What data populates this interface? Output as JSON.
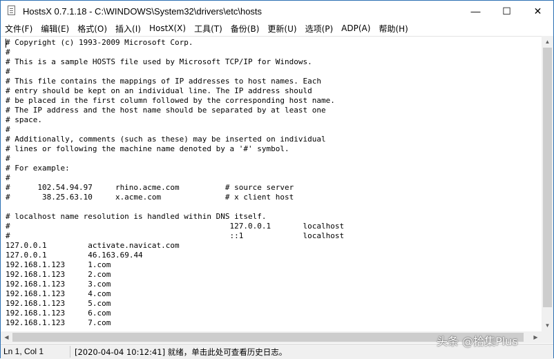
{
  "window": {
    "title": "HostsX 0.7.1.18 - C:\\WINDOWS\\System32\\drivers\\etc\\hosts",
    "minimize_glyph": "—",
    "maximize_glyph": "☐",
    "close_glyph": "✕"
  },
  "menu": [
    "文件(F)",
    "编辑(E)",
    "格式(O)",
    "插入(I)",
    "HostX(X)",
    "工具(T)",
    "备份(B)",
    "更新(U)",
    "选项(P)",
    "ADP(A)",
    "帮助(H)"
  ],
  "editor": {
    "text": "# Copyright (c) 1993-2009 Microsoft Corp.\n#\n# This is a sample HOSTS file used by Microsoft TCP/IP for Windows.\n#\n# This file contains the mappings of IP addresses to host names. Each\n# entry should be kept on an individual line. The IP address should\n# be placed in the first column followed by the corresponding host name.\n# The IP address and the host name should be separated by at least one\n# space.\n#\n# Additionally, comments (such as these) may be inserted on individual\n# lines or following the machine name denoted by a '#' symbol.\n#\n# For example:\n#\n#      102.54.94.97     rhino.acme.com          # source server\n#       38.25.63.10     x.acme.com              # x client host\n\n# localhost name resolution is handled within DNS itself.\n#\t\t\t\t\t\t 127.0.0.1       localhost\n#\t\t\t\t\t\t ::1             localhost\n127.0.0.1\t  activate.navicat.com\n127.0.0.1\t  46.163.69.44\n192.168.1.123\t  1.com\n192.168.1.123\t  2.com\n192.168.1.123\t  3.com\n192.168.1.123\t  4.com\n192.168.1.123\t  5.com\n192.168.1.123\t  6.com\n192.168.1.123\t  7.com"
  },
  "status": {
    "position": "Ln 1, Col 1",
    "message": "[2020-04-04 10:12:41] 就绪，单击此处可查看历史日志。"
  },
  "watermark": "头条 @拾集Plus",
  "icons": {
    "app": "notepad-page-icon",
    "scroll_up": "▲",
    "scroll_down": "▼",
    "scroll_left": "◀",
    "scroll_right": "▶"
  }
}
